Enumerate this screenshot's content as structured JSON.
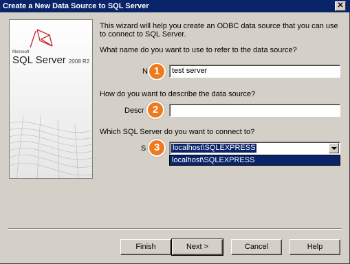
{
  "window": {
    "title": "Create a New Data Source to SQL Server",
    "close_glyph": "✕"
  },
  "logo": {
    "microsoft": "Microsoft",
    "product": "SQL Server",
    "version": "2008 R2"
  },
  "intro": "This wizard will help you create an ODBC data source that you can use to connect to SQL Server.",
  "name_question": "What name do you want to use to refer to the data source?",
  "name_label": "N",
  "name_value": "test server",
  "desc_question": "How do you want to describe the data source?",
  "desc_label": "Descr",
  "desc_value": "",
  "server_question": "Which SQL Server do you want to connect to?",
  "server_label": "S",
  "server_value": "localhost\\SQLEXPRESS",
  "server_options": [
    "localhost\\SQLEXPRESS"
  ],
  "badges": [
    "1",
    "2",
    "3"
  ],
  "badge_color": "#ee7a1e",
  "titlebar_color": "#0a246a",
  "buttons": {
    "finish": "Finish",
    "next": "Next >",
    "cancel": "Cancel",
    "help": "Help"
  }
}
